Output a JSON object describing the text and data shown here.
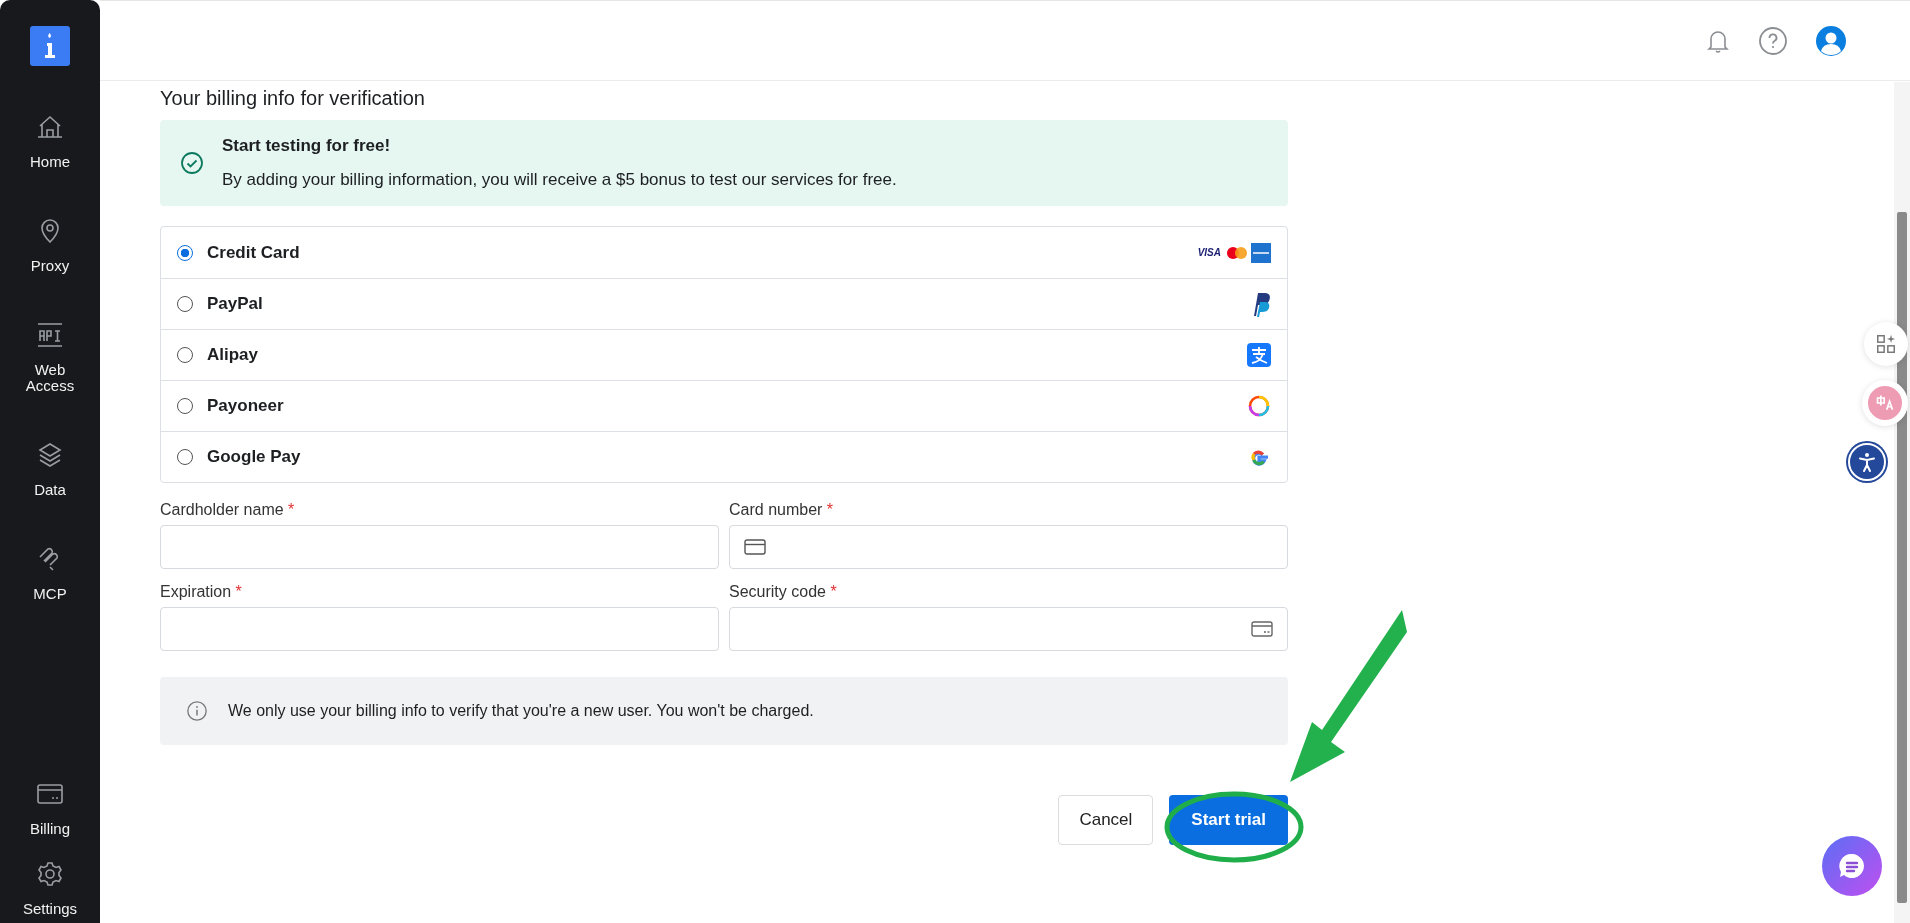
{
  "sidebar": {
    "items": [
      {
        "label": "Home",
        "kind": "home"
      },
      {
        "label": "Proxy",
        "kind": "pin"
      },
      {
        "label": "Web Access",
        "kind": "api"
      },
      {
        "label": "Data",
        "kind": "layers"
      },
      {
        "label": "MCP",
        "kind": "mcp"
      },
      {
        "label": "Billing",
        "kind": "card"
      },
      {
        "label": "Settings",
        "kind": "gear"
      }
    ]
  },
  "heading": "Your billing info for verification",
  "banner": {
    "title": "Start testing for free!",
    "text": "By adding your billing information, you will receive a $5 bonus to test our services for free."
  },
  "payment_methods": [
    {
      "label": "Credit Card",
      "selected": true,
      "kind": "cards",
      "brand": "VISA"
    },
    {
      "label": "PayPal",
      "selected": false,
      "kind": "paypal"
    },
    {
      "label": "Alipay",
      "selected": false,
      "kind": "alipay"
    },
    {
      "label": "Payoneer",
      "selected": false,
      "kind": "payoneer"
    },
    {
      "label": "Google Pay",
      "selected": false,
      "kind": "google"
    }
  ],
  "fields": [
    {
      "label": "Cardholder name",
      "marker": "*",
      "kind": "plain"
    },
    {
      "label": "Card number",
      "marker": "*",
      "kind": "card"
    },
    {
      "label": "Expiration",
      "marker": "*",
      "kind": "plain"
    },
    {
      "label": "Security code",
      "marker": "*",
      "kind": "cvc"
    }
  ],
  "notice": "We only use your billing info to verify that you're a new user. You won't be charged.",
  "buttons": [
    {
      "label": "Cancel",
      "kind": "secondary"
    },
    {
      "label": "Start trial",
      "kind": "primary"
    }
  ]
}
